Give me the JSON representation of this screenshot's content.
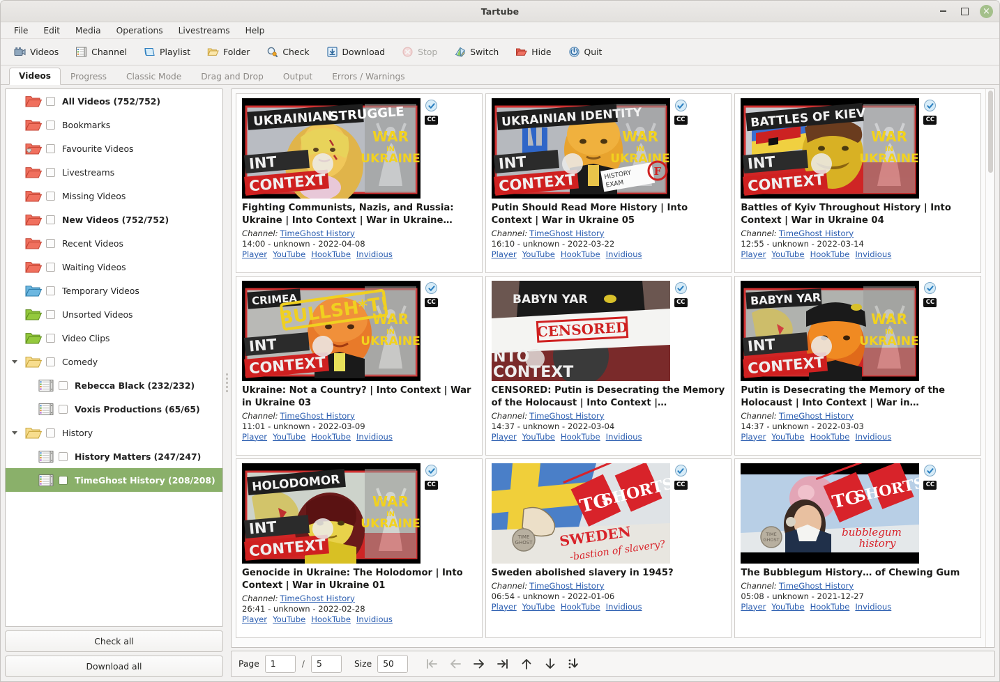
{
  "window": {
    "title": "Tartube",
    "controls": {
      "minimize": "minimize-button",
      "maximize": "maximize-button",
      "close": "×"
    }
  },
  "menubar": {
    "items": [
      "File",
      "Edit",
      "Media",
      "Operations",
      "Livestreams",
      "Help"
    ]
  },
  "toolbar": {
    "buttons": [
      {
        "label": "Videos",
        "icon": "videos-icon",
        "disabled": false
      },
      {
        "label": "Channel",
        "icon": "channel-icon",
        "disabled": false
      },
      {
        "label": "Playlist",
        "icon": "playlist-icon",
        "disabled": false
      },
      {
        "label": "Folder",
        "icon": "folder-icon",
        "disabled": false
      },
      {
        "label": "Check",
        "icon": "check-icon",
        "disabled": false
      },
      {
        "label": "Download",
        "icon": "download-icon",
        "disabled": false
      },
      {
        "label": "Stop",
        "icon": "stop-icon",
        "disabled": true
      },
      {
        "label": "Switch",
        "icon": "switch-icon",
        "disabled": false
      },
      {
        "label": "Hide",
        "icon": "hide-icon",
        "disabled": false
      },
      {
        "label": "Quit",
        "icon": "quit-icon",
        "disabled": false
      }
    ]
  },
  "tabs": {
    "items": [
      "Videos",
      "Progress",
      "Classic Mode",
      "Drag and Drop",
      "Output",
      "Errors / Warnings"
    ],
    "active": "Videos"
  },
  "sidebar": {
    "tree": [
      {
        "label": "All Videos (752/752)",
        "icon": "folder-red",
        "bold": true,
        "depth": 0,
        "expander": "none",
        "selected": false
      },
      {
        "label": "Bookmarks",
        "icon": "folder-red",
        "bold": false,
        "depth": 0,
        "expander": "none",
        "selected": false
      },
      {
        "label": "Favourite Videos",
        "icon": "folder-heart",
        "bold": false,
        "depth": 0,
        "expander": "none",
        "selected": false
      },
      {
        "label": "Livestreams",
        "icon": "folder-red",
        "bold": false,
        "depth": 0,
        "expander": "none",
        "selected": false
      },
      {
        "label": "Missing Videos",
        "icon": "folder-red",
        "bold": false,
        "depth": 0,
        "expander": "none",
        "selected": false
      },
      {
        "label": "New Videos (752/752)",
        "icon": "folder-red",
        "bold": true,
        "depth": 0,
        "expander": "none",
        "selected": false
      },
      {
        "label": "Recent Videos",
        "icon": "folder-red",
        "bold": false,
        "depth": 0,
        "expander": "none",
        "selected": false
      },
      {
        "label": "Waiting Videos",
        "icon": "folder-red",
        "bold": false,
        "depth": 0,
        "expander": "none",
        "selected": false
      },
      {
        "label": "Temporary Videos",
        "icon": "folder-blue",
        "bold": false,
        "depth": 0,
        "expander": "none",
        "selected": false
      },
      {
        "label": "Unsorted Videos",
        "icon": "folder-green",
        "bold": false,
        "depth": 0,
        "expander": "none",
        "selected": false
      },
      {
        "label": "Video Clips",
        "icon": "folder-green",
        "bold": false,
        "depth": 0,
        "expander": "none",
        "selected": false
      },
      {
        "label": "Comedy",
        "icon": "folder-yellow",
        "bold": false,
        "depth": 0,
        "expander": "expanded",
        "selected": false
      },
      {
        "label": "Rebecca Black (232/232)",
        "icon": "channel-list",
        "bold": true,
        "depth": 1,
        "expander": "none",
        "selected": false
      },
      {
        "label": "Voxis Productions (65/65)",
        "icon": "channel-list",
        "bold": true,
        "depth": 1,
        "expander": "none",
        "selected": false
      },
      {
        "label": "History",
        "icon": "folder-yellow",
        "bold": false,
        "depth": 0,
        "expander": "expanded",
        "selected": false
      },
      {
        "label": "History Matters (247/247)",
        "icon": "channel-list",
        "bold": true,
        "depth": 1,
        "expander": "none",
        "selected": false
      },
      {
        "label": "TimeGhost History (208/208)",
        "icon": "channel-list",
        "bold": true,
        "depth": 1,
        "expander": "none",
        "selected": true
      }
    ],
    "check_all_label": "Check all",
    "download_all_label": "Download all",
    "selection_color": "#8ab06a"
  },
  "videos": [
    {
      "title": "Fighting Communists, Nazis, and Russia: Ukraine | Into Context | War in Ukraine…",
      "channel_label": "Channel:",
      "channel": "TimeGhost History",
      "duration": "14:00",
      "size": "unknown",
      "date": "2022-04-08",
      "links": [
        "Player",
        "YouTube",
        "HookTube",
        "Invidious"
      ],
      "checked": true,
      "cc": "CC",
      "thumb": "ukrainian-struggle"
    },
    {
      "title": "Putin Should Read More History | Into Context | War in Ukraine 05",
      "channel_label": "Channel:",
      "channel": "TimeGhost History",
      "duration": "16:10",
      "size": "unknown",
      "date": "2022-03-22",
      "links": [
        "Player",
        "YouTube",
        "HookTube",
        "Invidious"
      ],
      "checked": true,
      "cc": "CC",
      "thumb": "ukrainian-identity"
    },
    {
      "title": "Battles of Kyiv Throughout History | Into Context | War in Ukraine 04",
      "channel_label": "Channel:",
      "channel": "TimeGhost History",
      "duration": "12:55",
      "size": "unknown",
      "date": "2022-03-14",
      "links": [
        "Player",
        "YouTube",
        "HookTube",
        "Invidious"
      ],
      "checked": true,
      "cc": "CC",
      "thumb": "battles-of-kiev"
    },
    {
      "title": "Ukraine: Not a Country? | Into Context | War in Ukraine 03",
      "channel_label": "Channel:",
      "channel": "TimeGhost History",
      "duration": "11:01",
      "size": "unknown",
      "date": "2022-03-09",
      "links": [
        "Player",
        "YouTube",
        "HookTube",
        "Invidious"
      ],
      "checked": true,
      "cc": "CC",
      "thumb": "crimea-bullshit"
    },
    {
      "title": "CENSORED: Putin is Desecrating the Memory of the Holocaust | Into Context |…",
      "channel_label": "Channel:",
      "channel": "TimeGhost History",
      "duration": "14:37",
      "size": "unknown",
      "date": "2022-03-04",
      "links": [
        "Player",
        "YouTube",
        "HookTube",
        "Invidious"
      ],
      "checked": true,
      "cc": "CC",
      "thumb": "babyn-yar-censored"
    },
    {
      "title": "Putin is Desecrating the Memory of the Holocaust | Into Context | War in…",
      "channel_label": "Channel:",
      "channel": "TimeGhost History",
      "duration": "14:37",
      "size": "unknown",
      "date": "2022-03-03",
      "links": [
        "Player",
        "YouTube",
        "HookTube",
        "Invidious"
      ],
      "checked": true,
      "cc": "CC",
      "thumb": "babyn-yar"
    },
    {
      "title": "Genocide in Ukraine: The Holodomor | Into Context | War in Ukraine 01",
      "channel_label": "Channel:",
      "channel": "TimeGhost History",
      "duration": "26:41",
      "size": "unknown",
      "date": "2022-02-28",
      "links": [
        "Player",
        "YouTube",
        "HookTube",
        "Invidious"
      ],
      "checked": true,
      "cc": "CC",
      "thumb": "holodomor"
    },
    {
      "title": "Sweden abolished slavery in 1945?",
      "channel_label": "Channel:",
      "channel": "TimeGhost History",
      "duration": "06:54",
      "size": "unknown",
      "date": "2022-01-06",
      "links": [
        "Player",
        "YouTube",
        "HookTube",
        "Invidious"
      ],
      "checked": true,
      "cc": "CC",
      "thumb": "sweden-slavery"
    },
    {
      "title": "The Bubblegum History… of Chewing Gum",
      "channel_label": "Channel:",
      "channel": "TimeGhost History",
      "duration": "05:08",
      "size": "unknown",
      "date": "2021-12-27",
      "links": [
        "Player",
        "YouTube",
        "HookTube",
        "Invidious"
      ],
      "checked": true,
      "cc": "CC",
      "thumb": "bubblegum"
    }
  ],
  "pagination": {
    "page_label": "Page",
    "page_value": "1",
    "separator": "/",
    "total_pages": "5",
    "size_label": "Size",
    "size_value": "50",
    "buttons": [
      {
        "name": "first-page-button",
        "glyph": "|←",
        "disabled": true
      },
      {
        "name": "previous-page-button",
        "glyph": "←",
        "disabled": true
      },
      {
        "name": "next-page-button",
        "glyph": "→",
        "disabled": false
      },
      {
        "name": "last-page-button",
        "glyph": "→|",
        "disabled": false
      },
      {
        "name": "scroll-up-button",
        "glyph": "↑",
        "disabled": false
      },
      {
        "name": "scroll-down-button",
        "glyph": "↓",
        "disabled": false
      },
      {
        "name": "scroll-to-bottom-button",
        "glyph": "⇟",
        "disabled": false
      }
    ]
  }
}
